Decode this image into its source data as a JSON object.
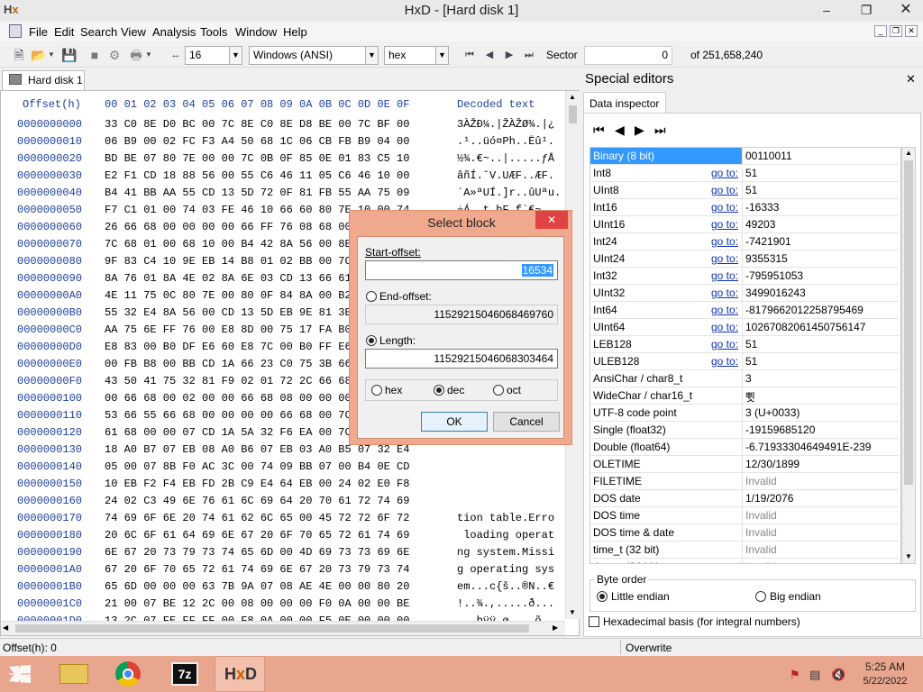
{
  "window": {
    "title": "HxD - [Hard disk 1]"
  },
  "menu": [
    "File",
    "Edit",
    "Search",
    "View",
    "Analysis",
    "Tools",
    "Window",
    "Help"
  ],
  "toolbar": {
    "bytes_per_row": "16",
    "charset": "Windows (ANSI)",
    "base": "hex",
    "sector_label": "Sector",
    "sector_value": "0",
    "sector_total": "of 251,658,240"
  },
  "tab": {
    "label": "Hard disk 1"
  },
  "hex": {
    "offset_header": "Offset(h)",
    "columns_header": "00 01 02 03 04 05 06 07 08 09 0A 0B 0C 0D 0E 0F",
    "decoded_header": "Decoded text",
    "rows": [
      {
        "o": "0000000000",
        "b": "33 C0 8E D0 BC 00 7C 8E C0 8E D8 BE 00 7C BF 00",
        "t": "3ÀŽÐ¼.|ŽÀŽØ¾.|¿"
      },
      {
        "o": "0000000010",
        "b": "06 B9 00 02 FC F3 A4 50 68 1C 06 CB FB B9 04 00",
        "t": ".¹..üó¤Ph..Ëû¹."
      },
      {
        "o": "0000000020",
        "b": "BD BE 07 80 7E 00 00 7C 0B 0F 85 0E 01 83 C5 10",
        "t": "½¾.€~..|.....ƒÅ"
      },
      {
        "o": "0000000030",
        "b": "E2 F1 CD 18 88 56 00 55 C6 46 11 05 C6 46 10 00",
        "t": "âñÍ.ˆV.UÆF..ÆF."
      },
      {
        "o": "0000000040",
        "b": "B4 41 BB AA 55 CD 13 5D 72 0F 81 FB 55 AA 75 09",
        "t": "´A»ªUÍ.]r..ûUªu."
      },
      {
        "o": "0000000050",
        "b": "F7 C1 01 00 74 03 FE 46 10 66 60 80 7E 10 00 74",
        "t": "÷Á..t.þF.f`€~.."
      },
      {
        "o": "0000000060",
        "b": "26 66 68 00 00 00 00 66 FF 76 08 68 00 00 68 00",
        "t": ""
      },
      {
        "o": "0000000070",
        "b": "7C 68 01 00 68 10 00 B4 42 8A 56 00 8B F4 CD 13",
        "t": ""
      },
      {
        "o": "0000000080",
        "b": "9F 83 C4 10 9E EB 14 B8 01 02 BB 00 7C 8A 56 00",
        "t": ""
      },
      {
        "o": "0000000090",
        "b": "8A 76 01 8A 4E 02 8A 6E 03 CD 13 66 61 73 1C FE",
        "t": ""
      },
      {
        "o": "00000000A0",
        "b": "4E 11 75 0C 80 7E 00 80 0F 84 8A 00 B2 80 EB 84",
        "t": ""
      },
      {
        "o": "00000000B0",
        "b": "55 32 E4 8A 56 00 CD 13 5D EB 9E 81 3E FE 7D 55",
        "t": ""
      },
      {
        "o": "00000000C0",
        "b": "AA 75 6E FF 76 00 E8 8D 00 75 17 FA B0 D1 E6 64",
        "t": ""
      },
      {
        "o": "00000000D0",
        "b": "E8 83 00 B0 DF E6 60 E8 7C 00 B0 FF E6 64 E8 75",
        "t": ""
      },
      {
        "o": "00000000E0",
        "b": "00 FB B8 00 BB CD 1A 66 23 C0 75 3B 66 81 FB 54",
        "t": ""
      },
      {
        "o": "00000000F0",
        "b": "43 50 41 75 32 81 F9 02 01 72 2C 66 68 07 BB 00",
        "t": ""
      },
      {
        "o": "0000000100",
        "b": "00 66 68 00 02 00 00 66 68 08 00 00 00 66 53 66",
        "t": ""
      },
      {
        "o": "0000000110",
        "b": "53 66 55 66 68 00 00 00 00 66 68 00 7C 00 00 66",
        "t": ""
      },
      {
        "o": "0000000120",
        "b": "61 68 00 00 07 CD 1A 5A 32 F6 EA 00 7C 00 00 CD",
        "t": ""
      },
      {
        "o": "0000000130",
        "b": "18 A0 B7 07 EB 08 A0 B6 07 EB 03 A0 B5 07 32 E4",
        "t": ""
      },
      {
        "o": "0000000140",
        "b": "05 00 07 8B F0 AC 3C 00 74 09 BB 07 00 B4 0E CD",
        "t": ""
      },
      {
        "o": "0000000150",
        "b": "10 EB F2 F4 EB FD 2B C9 E4 64 EB 00 24 02 E0 F8",
        "t": ""
      },
      {
        "o": "0000000160",
        "b": "24 02 C3 49 6E 76 61 6C 69 64 20 70 61 72 74 69",
        "t": ""
      },
      {
        "o": "0000000170",
        "b": "74 69 6F 6E 20 74 61 62 6C 65 00 45 72 72 6F 72",
        "t": "tion table.Erro"
      },
      {
        "o": "0000000180",
        "b": "20 6C 6F 61 64 69 6E 67 20 6F 70 65 72 61 74 69",
        "t": " loading operat"
      },
      {
        "o": "0000000190",
        "b": "6E 67 20 73 79 73 74 65 6D 00 4D 69 73 73 69 6E",
        "t": "ng system.Missi"
      },
      {
        "o": "00000001A0",
        "b": "67 20 6F 70 65 72 61 74 69 6E 67 20 73 79 73 74",
        "t": "g operating sys"
      },
      {
        "o": "00000001B0",
        "b": "65 6D 00 00 00 63 7B 9A 07 08 AE 4E 00 00 80 20",
        "t": "em...c{š..®N..€"
      },
      {
        "o": "00000001C0",
        "b": "21 00 07 BE 12 2C 00 08 00 00 00 F0 0A 00 00 BE",
        "t": "!..¾.,.....ð..."
      },
      {
        "o": "00000001D0",
        "b": "13 2C 07 FE FF FF 00 F8 0A 00 00 F5 0E 00 00 00",
        "t": ".,.þÿÿ.ø....õ.."
      },
      {
        "o": "00000001E0",
        "b": "00 00 00 00 00 00 00 00 00 00 00 00 00 00 00 00",
        "t": "................"
      },
      {
        "o": "00000001F0",
        "b": "00 00 00 00 00 00 00 00 00 00 00 00 00 00 55 AA",
        "t": "..............U"
      },
      {
        "o": "0000000200",
        "b": "00 00 00 00 00 00 00 00 00 00 00 00 00 00 00 00",
        "t": "................"
      },
      {
        "o": "0000000210",
        "b": "00 00 00 00 00 00 00 00 00 00 00 00 00 00 00 00",
        "t": "................"
      },
      {
        "o": "0000000220",
        "b": "00 00 00 00 00 00 00 00 00 00 00 00 00 00 00 00",
        "t": "................"
      }
    ]
  },
  "dialog": {
    "title": "Select block",
    "start_label": "Start-offset:",
    "start_value": "16534",
    "end_label": "End-offset:",
    "end_value": "11529215046068469760",
    "length_label": "Length:",
    "length_value": "11529215046068303464",
    "radix": [
      "hex",
      "dec",
      "oct"
    ],
    "ok": "OK",
    "cancel": "Cancel"
  },
  "special": {
    "title": "Special editors",
    "tab": "Data inspector",
    "rows": [
      {
        "name": "Binary (8 bit)",
        "goto": "",
        "value": "00110011",
        "selected": true
      },
      {
        "name": "Int8",
        "goto": "go to:",
        "value": "51"
      },
      {
        "name": "UInt8",
        "goto": "go to:",
        "value": "51"
      },
      {
        "name": "Int16",
        "goto": "go to:",
        "value": "-16333"
      },
      {
        "name": "UInt16",
        "goto": "go to:",
        "value": "49203"
      },
      {
        "name": "Int24",
        "goto": "go to:",
        "value": "-7421901"
      },
      {
        "name": "UInt24",
        "goto": "go to:",
        "value": "9355315"
      },
      {
        "name": "Int32",
        "goto": "go to:",
        "value": "-795951053"
      },
      {
        "name": "UInt32",
        "goto": "go to:",
        "value": "3499016243"
      },
      {
        "name": "Int64",
        "goto": "go to:",
        "value": "-8179662012258795469"
      },
      {
        "name": "UInt64",
        "goto": "go to:",
        "value": "10267082061450756147"
      },
      {
        "name": "LEB128",
        "goto": "go to:",
        "value": "51"
      },
      {
        "name": "ULEB128",
        "goto": "go to:",
        "value": "51"
      },
      {
        "name": "AnsiChar / char8_t",
        "goto": "",
        "value": "3"
      },
      {
        "name": "WideChar / char16_t",
        "goto": "",
        "value": "쀳"
      },
      {
        "name": "UTF-8 code point",
        "goto": "",
        "value": "3 (U+0033)"
      },
      {
        "name": "Single (float32)",
        "goto": "",
        "value": "-19159685120"
      },
      {
        "name": "Double (float64)",
        "goto": "",
        "value": "-6.71933304649491E-239"
      },
      {
        "name": "OLETIME",
        "goto": "",
        "value": "12/30/1899"
      },
      {
        "name": "FILETIME",
        "goto": "",
        "value": "Invalid",
        "muted": true
      },
      {
        "name": "DOS date",
        "goto": "",
        "value": "1/19/2076"
      },
      {
        "name": "DOS time",
        "goto": "",
        "value": "Invalid",
        "muted": true
      },
      {
        "name": "DOS time & date",
        "goto": "",
        "value": "Invalid",
        "muted": true
      },
      {
        "name": "time_t (32 bit)",
        "goto": "",
        "value": "Invalid",
        "muted": true
      },
      {
        "name": "time_t (64 bit)",
        "goto": "",
        "value": "Invalid",
        "muted": true
      }
    ],
    "byte_order_label": "Byte order",
    "little_endian": "Little endian",
    "big_endian": "Big endian",
    "hex_basis": "Hexadecimal basis (for integral numbers)"
  },
  "status": {
    "offset": "Offset(h): 0",
    "mode": "Overwrite"
  },
  "taskbar": {
    "time": "5:25 AM",
    "date": "5/22/2022"
  },
  "colors": {
    "selection": "#3399ff",
    "dialog_frame": "#f0a98d",
    "taskbar": "#e8a68e",
    "offset_text": "#1c3e9c"
  }
}
